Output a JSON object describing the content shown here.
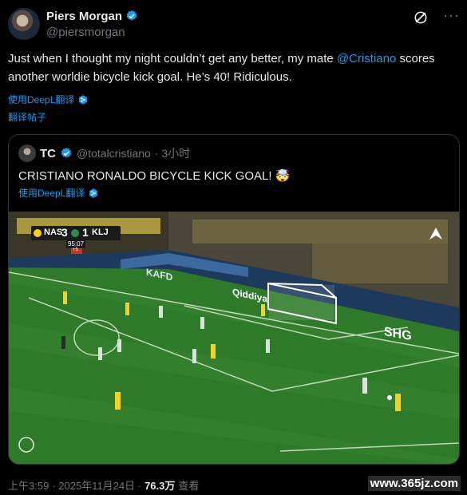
{
  "post": {
    "author_name": "Piers Morgan",
    "author_handle": "@piersmorgan",
    "text_before": "Just when I thought my night couldn’t get any better, my mate ",
    "mention": "@Cristiano",
    "text_after": " scores another worldie bicycle kick goal. He’s 40! Ridiculous.",
    "translate_label": "使用DeepL翻译",
    "translate_post": "翻译帖子"
  },
  "quote": {
    "name": "TC",
    "handle": "@totalcristiano",
    "time": "· 3小时",
    "text": "CRISTIANO RONALDO BICYCLE KICK GOAL! 🤯",
    "translate_label": "使用DeepL翻译"
  },
  "scoreboard": {
    "home": "NAS",
    "home_score": "3",
    "away_score": "1",
    "away": "KLJ",
    "clock": "95:07",
    "added": "+5"
  },
  "boards": {
    "kafd": "KAFD",
    "qiddiya": "Qiddiya",
    "shg": "SHG"
  },
  "footer": {
    "time": "上午3:59",
    "date": "· 2025年11月24日 ·",
    "views": "76.3万",
    "views_label": "查看"
  },
  "watermark": "www.365jz.com",
  "colors": {
    "accent": "#1d9bf0",
    "pitch": "#2e7a2a",
    "muted": "#71767b"
  }
}
